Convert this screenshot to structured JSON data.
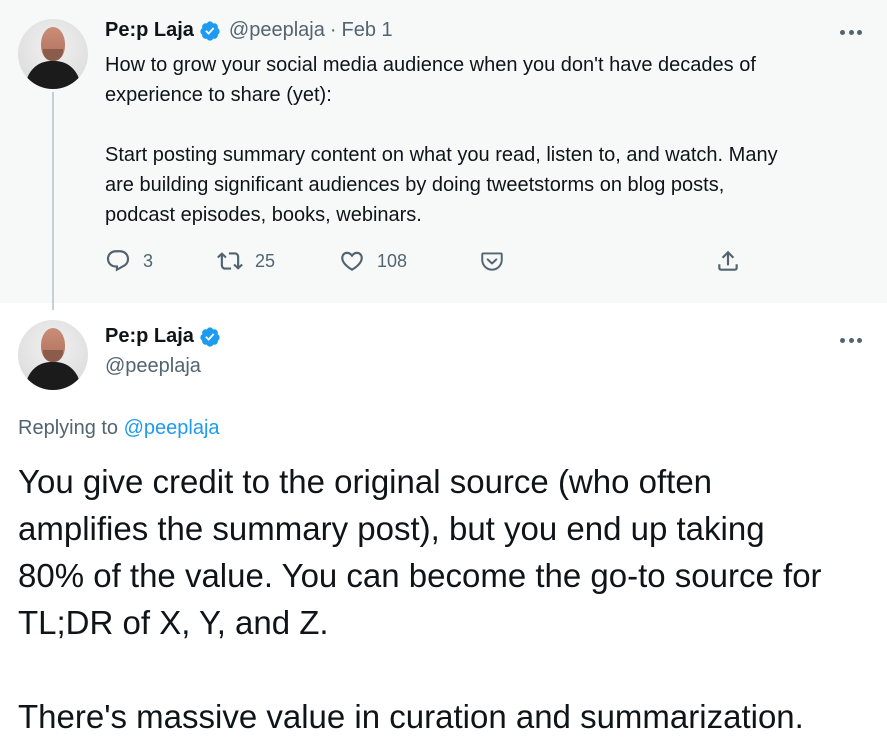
{
  "parent": {
    "name": "Pe:p Laja",
    "handle": "@peeplaja",
    "separator": "·",
    "date": "Feb 1",
    "text": "How to grow your social media audience when you don't have decades of\nexperience to share (yet):\n\nStart posting summary content on what you read, listen to, and watch. Many\nare building significant audiences by doing tweetstorms on blog posts,\npodcast episodes, books, webinars.",
    "replies": "3",
    "retweets": "25",
    "likes": "108"
  },
  "current": {
    "name": "Pe:p Laja",
    "handle": "@peeplaja",
    "replying_prefix": "Replying to",
    "replying_to": "@peeplaja",
    "text": "You give credit to the original source (who often\namplifies the summary post), but you end up taking\n80% of the value. You can become the go-to source for\nTL;DR of X, Y, and Z.\n\nThere's massive value in curation and summarization."
  },
  "icons": {
    "verified": "verified-badge-icon",
    "more": "more-icon",
    "reply": "reply-icon",
    "retweet": "retweet-icon",
    "like": "like-icon",
    "pocket": "pocket-icon",
    "share": "share-icon"
  },
  "colors": {
    "accent": "#1d9bf0",
    "muted": "#536471",
    "text": "#0f1419",
    "parent_background": "#f7f9f9",
    "thread_line": "#c4cfd6"
  }
}
